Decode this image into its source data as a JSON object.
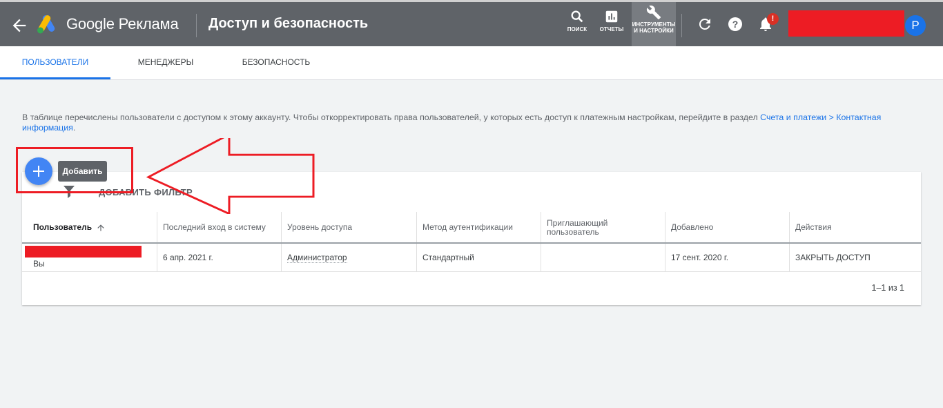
{
  "header": {
    "brand": "Google Реклама",
    "title": "Доступ и безопасность",
    "tools": [
      {
        "label": "ПОИСК",
        "icon": "search-icon"
      },
      {
        "label": "ОТЧЕТЫ",
        "icon": "reports-icon"
      },
      {
        "label": "ИНСТРУМЕНТЫ И НАСТРОЙКИ",
        "icon": "wrench-icon",
        "active": true
      }
    ],
    "notification_badge": "!",
    "avatar_letter": "P"
  },
  "tabs": [
    {
      "label": "ПОЛЬЗОВАТЕЛИ",
      "active": true
    },
    {
      "label": "МЕНЕДЖЕРЫ",
      "active": false
    },
    {
      "label": "БЕЗОПАСНОСТЬ",
      "active": false
    }
  ],
  "info": {
    "text": "В таблице перечислены пользователи с доступом к этому аккаунту. Чтобы откорректировать права пользователей, у которых есть доступ к платежным настройкам, перейдите в раздел",
    "link": "Счета и платежи > Контактная информация",
    "end": "."
  },
  "fab": {
    "tooltip": "Добавить"
  },
  "filter": {
    "label": "ДОБАВИТЬ ФИЛЬТР"
  },
  "table": {
    "columns": [
      "Пользователь",
      "Последний вход в систему",
      "Уровень доступа",
      "Метод аутентификации",
      "Приглашающий пользователь",
      "Добавлено",
      "Действия"
    ],
    "rows": [
      {
        "user_note": "Вы",
        "last_login": "6 апр. 2021 г.",
        "access_level": "Администратор",
        "auth_method": "Стандартный",
        "inviter": "",
        "added": "17 сент. 2020 г.",
        "action": "ЗАКРЫТЬ ДОСТУП"
      }
    ]
  },
  "pagination": "1–1 из 1",
  "colors": {
    "header_bg": "#5f6368",
    "accent": "#1a73e8",
    "annotation": "#ed1c24",
    "fab": "#4285f4"
  }
}
